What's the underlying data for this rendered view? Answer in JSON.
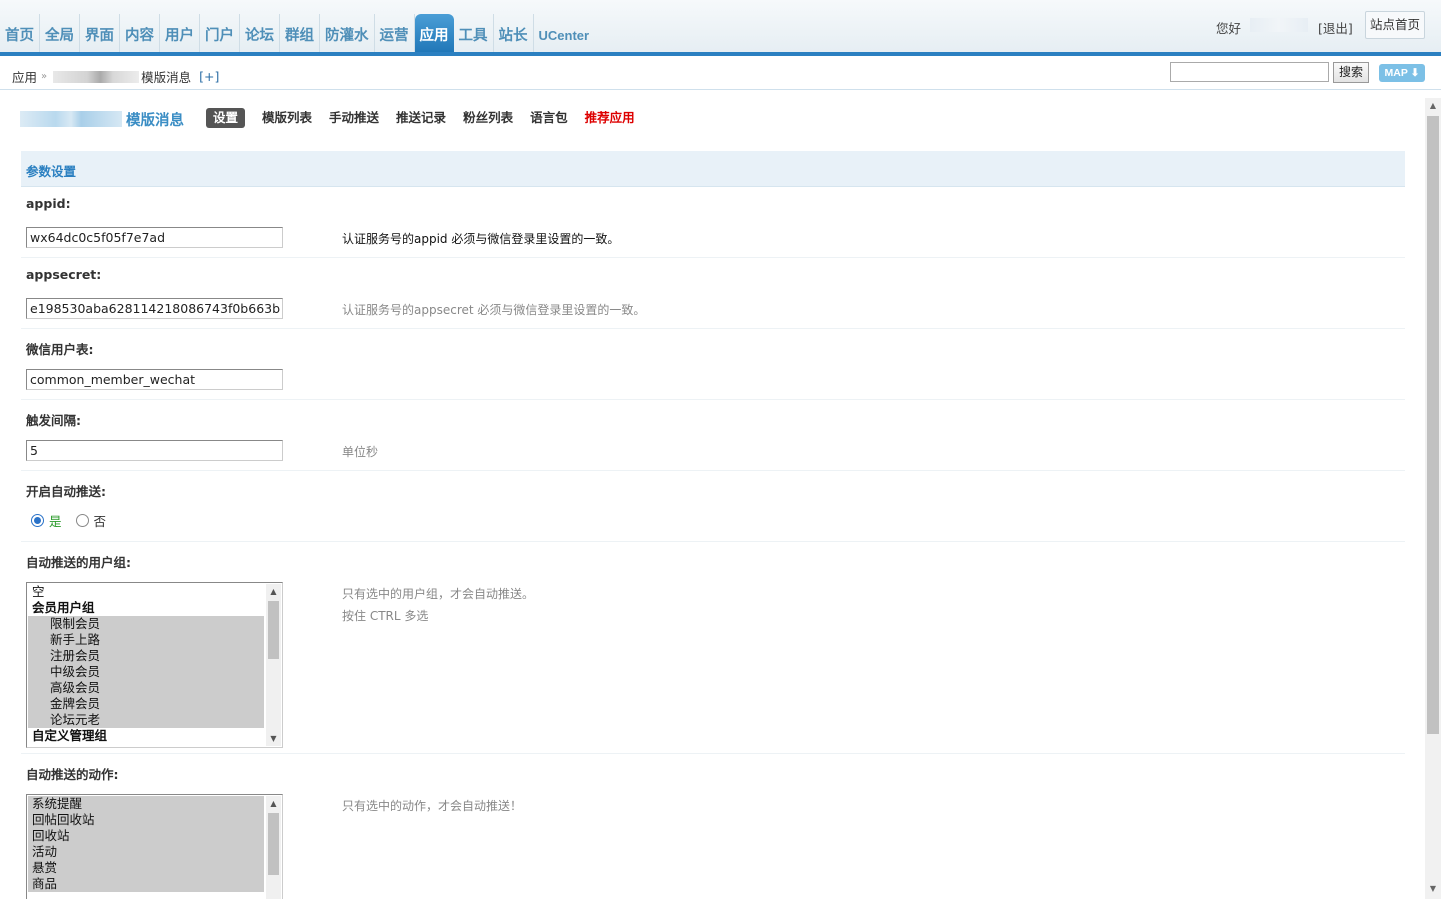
{
  "nav": {
    "items": [
      "首页",
      "全局",
      "界面",
      "内容",
      "用户",
      "门户",
      "论坛",
      "群组",
      "防灌水",
      "运营",
      "应用",
      "工具",
      "站长",
      "UCenter"
    ],
    "active_index": 10
  },
  "header": {
    "greeting": "您好",
    "logout": "[退出]",
    "site_home": "站点首页"
  },
  "breadcrumb": {
    "root": "应用",
    "current": "模版消息",
    "add": "[+]"
  },
  "search": {
    "button": "搜索",
    "value": "",
    "map_button": "MAP"
  },
  "plugin": {
    "name": "模版消息",
    "tabs": [
      {
        "label": "设置",
        "active": true
      },
      {
        "label": "模版列表"
      },
      {
        "label": "手动推送"
      },
      {
        "label": "推送记录"
      },
      {
        "label": "粉丝列表"
      },
      {
        "label": "语言包"
      },
      {
        "label": "推荐应用",
        "highlight": "#dd0000"
      }
    ]
  },
  "section": {
    "title": "参数设置"
  },
  "fields": {
    "appid": {
      "label": "appid:",
      "value": "wx64dc0c5f05f7e7ad",
      "tip": "认证服务号的appid 必须与微信登录里设置的一致。"
    },
    "appsecret": {
      "label": "appsecret:",
      "value": "e198530aba628114218086743f0b663b",
      "tip": "认证服务号的appsecret 必须与微信登录里设置的一致。"
    },
    "user_table": {
      "label": "微信用户表:",
      "value": "common_member_wechat"
    },
    "interval": {
      "label": "触发间隔:",
      "value": "5",
      "tip": "单位秒"
    },
    "auto_push": {
      "label": "开启自动推送:",
      "options": [
        "是",
        "否"
      ],
      "selected": "是"
    },
    "user_groups": {
      "label": "自动推送的用户组:",
      "tip": "只有选中的用户组，才会自动推送。",
      "tip2": "按住 CTRL 多选",
      "options": [
        {
          "text": "空",
          "selected": false
        },
        {
          "text": "会员用户组",
          "selected": false,
          "group": true
        },
        {
          "text": "限制会员",
          "selected": true
        },
        {
          "text": "新手上路",
          "selected": true
        },
        {
          "text": "注册会员",
          "selected": true
        },
        {
          "text": "中级会员",
          "selected": true
        },
        {
          "text": "高级会员",
          "selected": true
        },
        {
          "text": "金牌会员",
          "selected": true
        },
        {
          "text": "论坛元老",
          "selected": true
        },
        {
          "text": "自定义管理组",
          "selected": false,
          "group": true
        }
      ]
    },
    "actions": {
      "label": "自动推送的动作:",
      "tip": "只有选中的动作，才会自动推送！",
      "options": [
        {
          "text": "系统提醒",
          "selected": true
        },
        {
          "text": "回帖回收站",
          "selected": true
        },
        {
          "text": "回收站",
          "selected": true
        },
        {
          "text": "活动",
          "selected": true
        },
        {
          "text": "悬赏",
          "selected": true
        },
        {
          "text": "商品",
          "selected": true
        }
      ]
    }
  }
}
